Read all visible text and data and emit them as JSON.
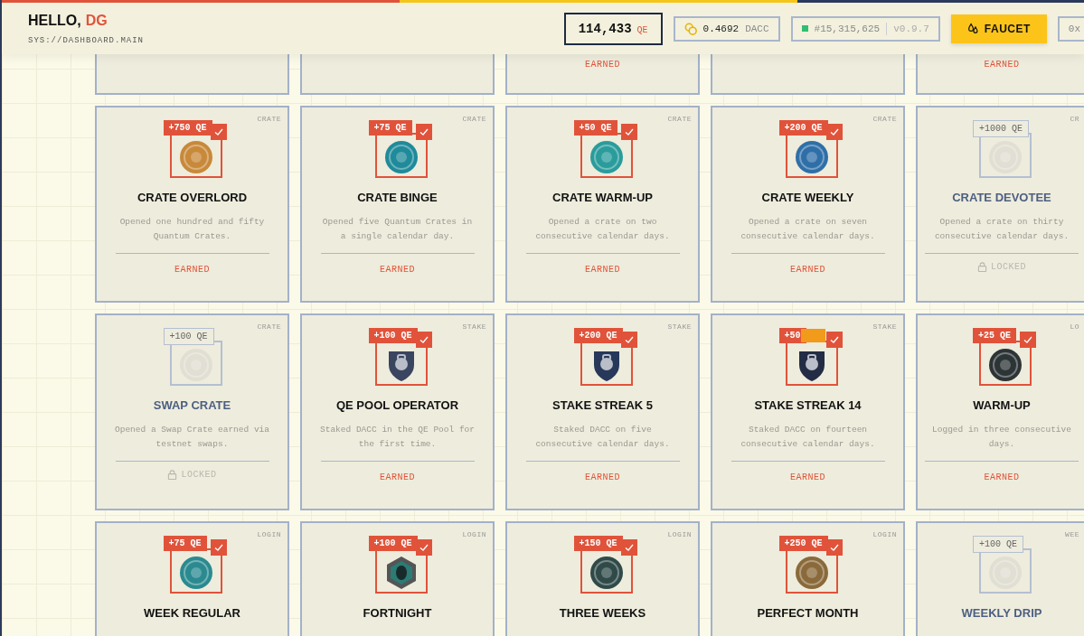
{
  "header": {
    "greeting": "HELLO,",
    "name": "DG",
    "subtitle": "SYS://DASHBOARD.MAIN",
    "balance": "114,433",
    "balance_unit": "QE",
    "dacc_amount": "0.4692",
    "dacc_unit": "DACC",
    "block": "#15,315,625",
    "version": "v0.9.7",
    "faucet_label": "FAUCET",
    "wallet_label": "0x"
  },
  "top_row": [
    {
      "kind": "blank"
    },
    {
      "kind": "blank"
    },
    {
      "kind": "status",
      "status": "EARNED"
    },
    {
      "kind": "blank"
    },
    {
      "kind": "status",
      "status": "EARNED"
    }
  ],
  "cards": [
    {
      "category": "CRATE",
      "reward": "+750 QE",
      "earned": true,
      "title": "CRATE OVERLORD",
      "description": "Opened one hundred and fifty Quantum Crates.",
      "status": "EARNED",
      "kind": "coin",
      "color": "#c8893a"
    },
    {
      "category": "CRATE",
      "reward": "+75 QE",
      "earned": true,
      "title": "CRATE BINGE",
      "description": "Opened five Quantum Crates in a single calendar day.",
      "status": "EARNED",
      "kind": "coin",
      "color": "#1f8a9a"
    },
    {
      "category": "CRATE",
      "reward": "+50 QE",
      "earned": true,
      "title": "CRATE WARM-UP",
      "description": "Opened a crate on two consecutive calendar days.",
      "status": "EARNED",
      "kind": "coin",
      "color": "#2a9c9c"
    },
    {
      "category": "CRATE",
      "reward": "+200 QE",
      "earned": true,
      "title": "CRATE WEEKLY",
      "description": "Opened a crate on seven consecutive calendar days.",
      "status": "EARNED",
      "kind": "coin",
      "color": "#2f6fa8"
    },
    {
      "category": "CR",
      "reward": "+1000 QE",
      "earned": false,
      "title": "CRATE DEVOTEE",
      "description": "Opened a crate on thirty consecutive calendar days.",
      "status": "LOCKED",
      "kind": "coin",
      "color": "#dcdad0"
    },
    {
      "category": "CRATE",
      "reward": "+100 QE",
      "earned": false,
      "title": "SWAP CRATE",
      "description": "Opened a Swap Crate earned via testnet swaps.",
      "status": "LOCKED",
      "kind": "coin",
      "color": "#dcdad0"
    },
    {
      "category": "STAKE",
      "reward": "+100 QE",
      "earned": true,
      "title": "QE POOL OPERATOR",
      "description": "Staked DACC in the QE Pool for the first time.",
      "status": "EARNED",
      "kind": "shield",
      "color": "#3a4560"
    },
    {
      "category": "STAKE",
      "reward": "+200 QE",
      "earned": true,
      "title": "STAKE STREAK 5",
      "description": "Staked DACC on five consecutive calendar days.",
      "status": "EARNED",
      "kind": "shield",
      "color": "#27385a"
    },
    {
      "category": "STAKE",
      "reward": "+50",
      "flagged": true,
      "earned": true,
      "title": "STAKE STREAK 14",
      "description": "Staked DACC on fourteen consecutive calendar days.",
      "status": "EARNED",
      "kind": "shield",
      "color": "#222c44"
    },
    {
      "category": "LO",
      "reward": "+25 QE",
      "earned": true,
      "title": "WARM-UP",
      "description": "Logged in three consecutive days.",
      "status": "EARNED",
      "kind": "coin",
      "color": "#2d3436"
    },
    {
      "category": "LOGIN",
      "reward": "+75 QE",
      "earned": true,
      "title": "WEEK REGULAR",
      "kind": "coin",
      "color": "#2a8a90"
    },
    {
      "category": "LOGIN",
      "reward": "+100 QE",
      "earned": true,
      "title": "FORTNIGHT",
      "kind": "hex",
      "color": "#2a7c74"
    },
    {
      "category": "LOGIN",
      "reward": "+150 QE",
      "earned": true,
      "title": "THREE WEEKS",
      "kind": "coin",
      "color": "#2f4a48"
    },
    {
      "category": "LOGIN",
      "reward": "+250 QE",
      "earned": true,
      "title": "PERFECT MONTH",
      "kind": "coin",
      "color": "#8a6a3a"
    },
    {
      "category": "WEE",
      "reward": "+100 QE",
      "earned": false,
      "title": "WEEKLY DRIP",
      "kind": "coin",
      "color": "#dcdad0"
    }
  ]
}
